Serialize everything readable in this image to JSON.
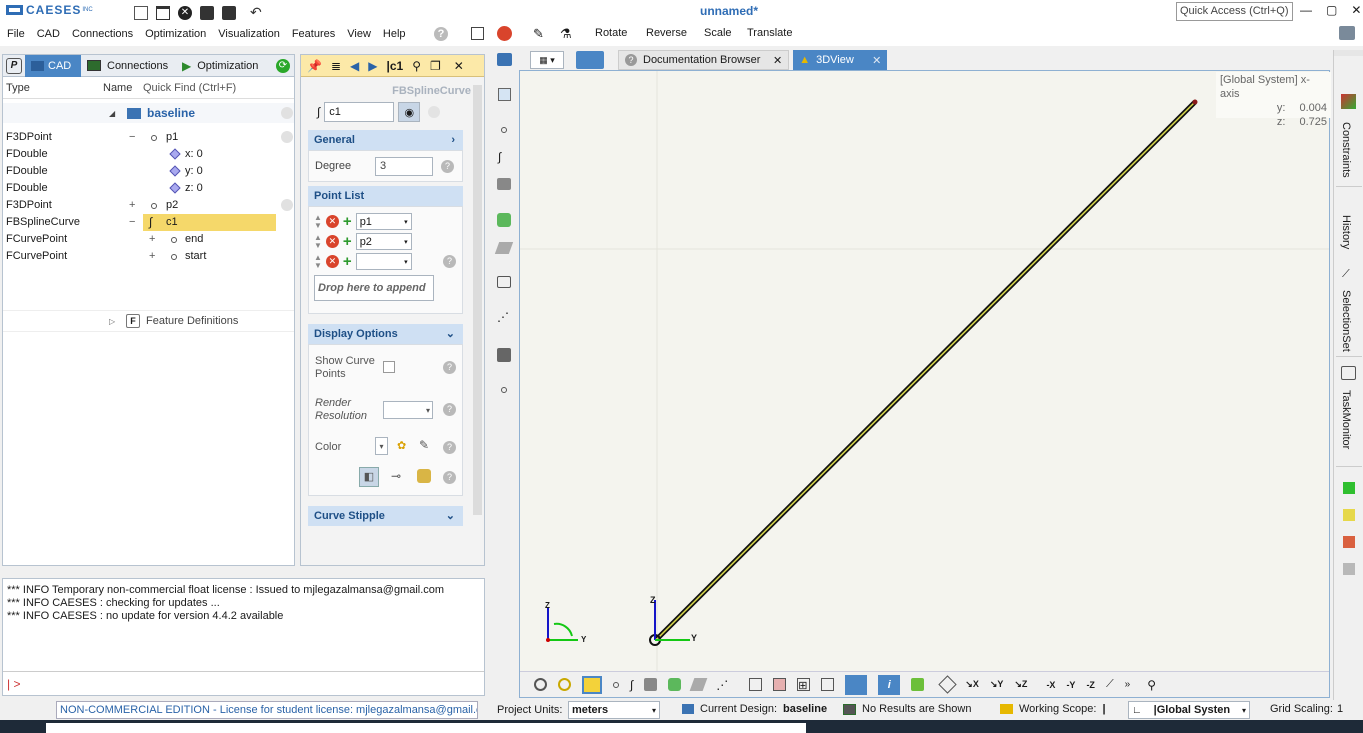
{
  "app": {
    "logo": "CAESES",
    "logo_suffix": "INC",
    "title": "unnamed*",
    "quick_access": "Quick Access (Ctrl+Q)"
  },
  "menu": [
    "File",
    "CAD",
    "Connections",
    "Optimization",
    "Visualization",
    "Features",
    "View",
    "Help"
  ],
  "toolbar": {
    "rotate": "Rotate",
    "reverse": "Reverse",
    "scale": "Scale",
    "translate": "Translate"
  },
  "left_tabs": {
    "cad": "CAD",
    "connections": "Connections",
    "optimization": "Optimization"
  },
  "tree_header": {
    "type": "Type",
    "name": "Name",
    "quick_find": "Quick Find (Ctrl+F)"
  },
  "tree": [
    {
      "type": "",
      "exp": "",
      "name": "baseline"
    },
    {
      "type": "F3DPoint",
      "exp": "−",
      "name": "p1"
    },
    {
      "type": "FDouble",
      "exp": "",
      "name": "x: 0"
    },
    {
      "type": "FDouble",
      "exp": "",
      "name": "y: 0"
    },
    {
      "type": "FDouble",
      "exp": "",
      "name": "z: 0"
    },
    {
      "type": "F3DPoint",
      "exp": "+",
      "name": "p2"
    },
    {
      "type": "FBSplineCurve",
      "exp": "−",
      "name": "c1"
    },
    {
      "type": "FCurvePoint",
      "exp": "+",
      "name": "end"
    },
    {
      "type": "FCurvePoint",
      "exp": "+",
      "name": "start"
    },
    {
      "type": "",
      "exp": "",
      "name": "Feature Definitions"
    }
  ],
  "props": {
    "header_name": "|c1",
    "type_label": "FBSplineCurve",
    "name_value": "c1",
    "general": "General",
    "degree_label": "Degree",
    "degree_value": "3",
    "point_list": "Point List",
    "points": [
      "p1",
      "p2",
      ""
    ],
    "drop_placeholder": "Drop here to append",
    "display_options": "Display Options",
    "show_curve_points": "Show Curve Points",
    "render_resolution": "Render Resolution",
    "color": "Color",
    "curve_stipple": "Curve Stipple"
  },
  "console": {
    "lines": [
      "*** INFO Temporary non-commercial float license : Issued to mjlegazalmansa@gmail.com",
      "*** INFO CAESES : checking for updates ...",
      "*** INFO CAESES : no update for version 4.4.2 available"
    ],
    "prompt": "| >"
  },
  "doc_tabs": {
    "doc_browser": "Documentation Browser",
    "view3d": "3DView"
  },
  "viewer": {
    "system_label": "[Global System]  x-axis",
    "y_label": "y:",
    "y_value": "0.004",
    "z_label": "z:",
    "z_value": "0.725",
    "axis_z": "Z",
    "axis_y": "Y"
  },
  "right_tabs": [
    "Constraints",
    "History",
    "SelectionSet",
    "TaskMonitor"
  ],
  "status_colors": [
    "#2fbf2f",
    "#e6d84a",
    "#d9603f",
    "#b8b8b8"
  ],
  "statusbar": {
    "license": "NON-COMMERCIAL EDITION - License for student license: mjlegazalmansa@gmail.com",
    "units_label": "Project Units:",
    "units_value": "meters",
    "design_label": "Current Design:",
    "design_value": "baseline",
    "results": "No Results are Shown",
    "scope_label": "Working Scope:",
    "scope_value": "|",
    "system_value": "|Global Systen",
    "grid_label": "Grid Scaling:",
    "grid_value": "1"
  }
}
